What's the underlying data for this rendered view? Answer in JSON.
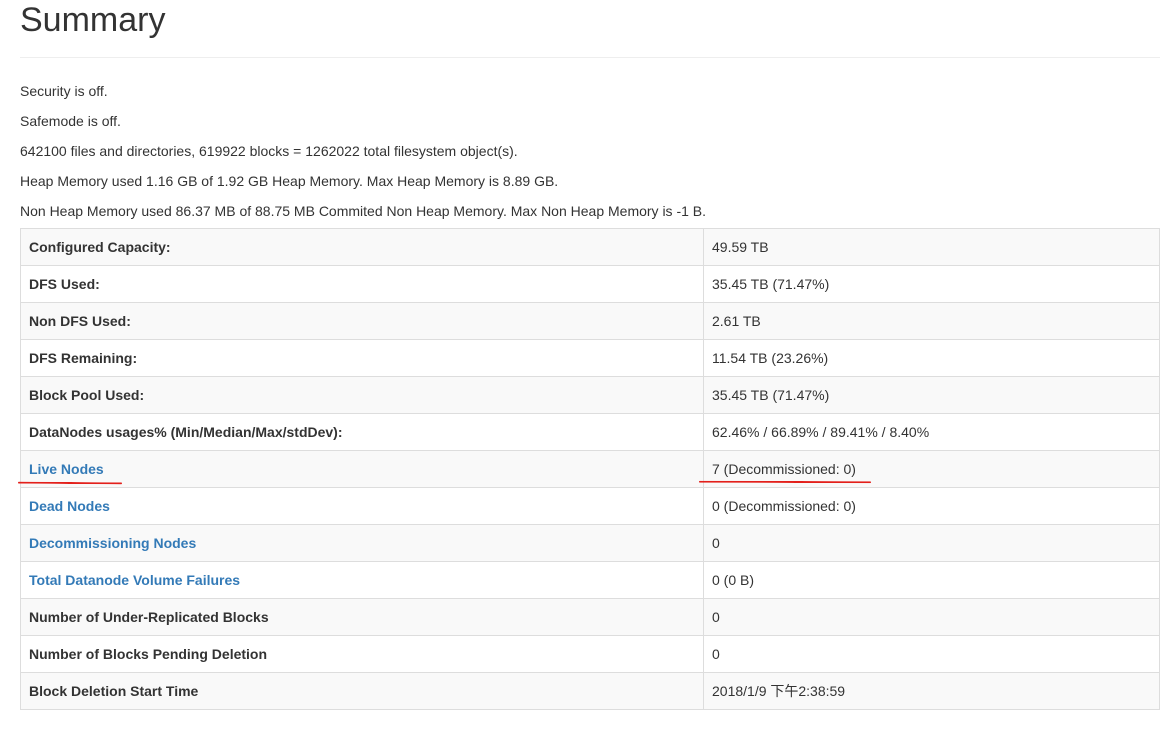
{
  "page": {
    "title": "Summary"
  },
  "info_lines": [
    "Security is off.",
    "Safemode is off.",
    "642100 files and directories, 619922 blocks = 1262022 total filesystem object(s).",
    "Heap Memory used 1.16 GB of 1.92 GB Heap Memory. Max Heap Memory is 8.89 GB.",
    "Non Heap Memory used 86.37 MB of 88.75 MB Commited Non Heap Memory. Max Non Heap Memory is -1 B."
  ],
  "table": {
    "rows": [
      {
        "key": "Configured Capacity:",
        "value": "49.59 TB"
      },
      {
        "key": "DFS Used:",
        "value": "35.45 TB (71.47%)"
      },
      {
        "key": "Non DFS Used:",
        "value": "2.61 TB"
      },
      {
        "key": "DFS Remaining:",
        "value": "11.54 TB (23.26%)"
      },
      {
        "key": "Block Pool Used:",
        "value": "35.45 TB (71.47%)"
      },
      {
        "key": "DataNodes usages% (Min/Median/Max/stdDev):",
        "value": "62.46% / 66.89% / 89.41% / 8.40%"
      },
      {
        "key": "Live Nodes",
        "value": "7 (Decommissioned: 0)"
      },
      {
        "key": "Dead Nodes",
        "value": "0 (Decommissioned: 0)"
      },
      {
        "key": "Decommissioning Nodes",
        "value": "0"
      },
      {
        "key": "Total Datanode Volume Failures",
        "value": "0 (0 B)"
      },
      {
        "key": "Number of Under-Replicated Blocks",
        "value": "0"
      },
      {
        "key": "Number of Blocks Pending Deletion",
        "value": "0"
      },
      {
        "key": "Block Deletion Start Time",
        "value": "2018/1/9 下午2:38:59"
      }
    ]
  },
  "colors": {
    "text": "#333333",
    "link": "#337ab7",
    "border": "#dddddd",
    "stripe": "#f9f9f9",
    "annotation": "#e3201b"
  }
}
